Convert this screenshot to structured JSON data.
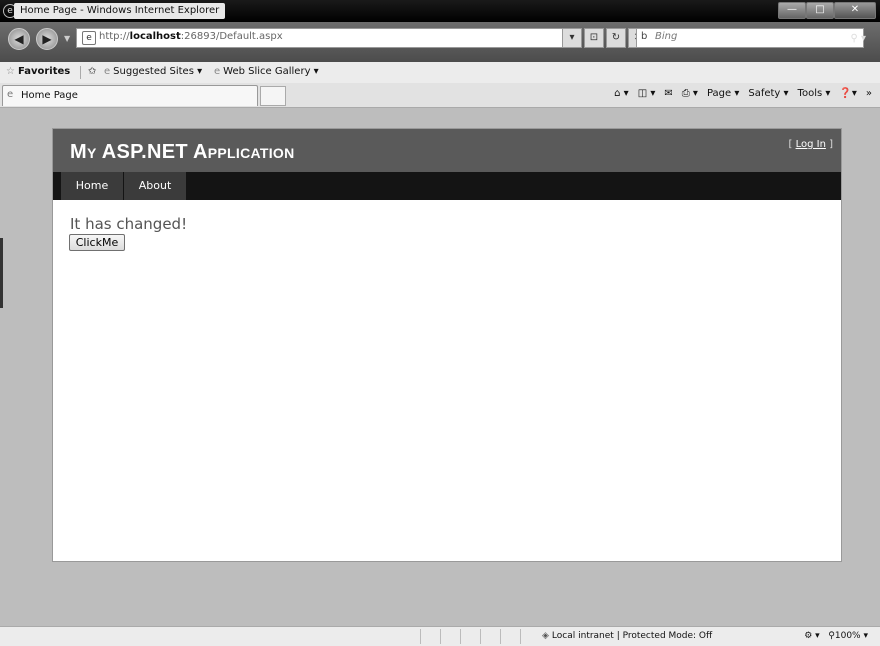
{
  "window": {
    "title": "Home Page - Windows Internet Explorer",
    "minimize_glyph": "—",
    "maximize_glyph": "□",
    "close_glyph": "✕"
  },
  "address_bar": {
    "url_prefix": "http://",
    "url_host": "localhost",
    "url_rest": ":26893/Default.aspx",
    "search_placeholder": "Bing"
  },
  "favorites_bar": {
    "favorites_label": "Favorites",
    "suggested_sites_label": "Suggested Sites ▾",
    "web_slice_label": "Web Slice Gallery ▾"
  },
  "tab": {
    "label": "Home Page"
  },
  "command_bar": {
    "page_label": "Page ▾",
    "safety_label": "Safety ▾",
    "tools_label": "Tools ▾"
  },
  "site": {
    "title": "My ASP.NET Application",
    "login_prefix": "[ ",
    "login_link": "Log In",
    "login_suffix": " ]",
    "menu": [
      {
        "label": "Home"
      },
      {
        "label": "About"
      }
    ],
    "main_text": "It has changed!",
    "button_label": "ClickMe"
  },
  "status_bar": {
    "zone_text": "Local intranet | Protected Mode: Off",
    "zoom_text": "100%"
  }
}
